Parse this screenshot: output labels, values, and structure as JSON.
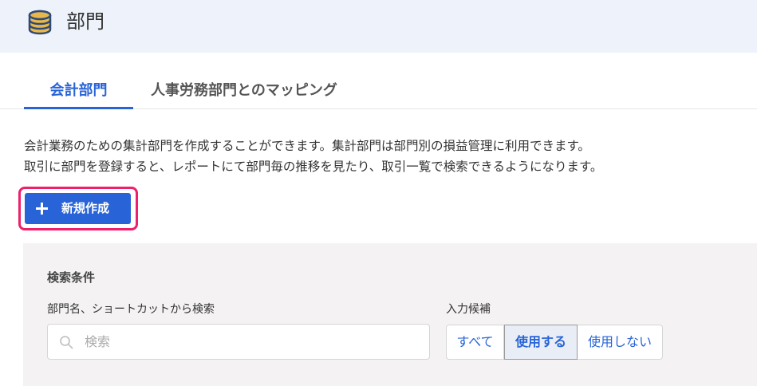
{
  "header": {
    "title": "部門",
    "icon": "database-icon",
    "icon_color": "#e9b84a",
    "icon_outline": "#2e4a78",
    "background": "#eef3fb"
  },
  "tabs": [
    {
      "label": "会計部門",
      "active": true
    },
    {
      "label": "人事労務部門とのマッピング",
      "active": false
    }
  ],
  "description": {
    "line1": "会計業務のための集計部門を作成することができます。集計部門は部門別の損益管理に利用できます。",
    "line2": "取引に部門を登録すると、レポートにて部門毎の推移を見たり、取引一覧で検索できるようになります。"
  },
  "create_button": {
    "label": "新規作成",
    "icon": "plus-icon",
    "color": "#2864d8",
    "highlight_color": "#ee1f6b"
  },
  "search": {
    "title": "検索条件",
    "name_label": "部門名、ショートカットから検索",
    "placeholder": "検索",
    "value": "",
    "filter_label": "入力候補",
    "filter_options": [
      "すべて",
      "使用する",
      "使用しない"
    ],
    "selected_filter": "使用する"
  }
}
